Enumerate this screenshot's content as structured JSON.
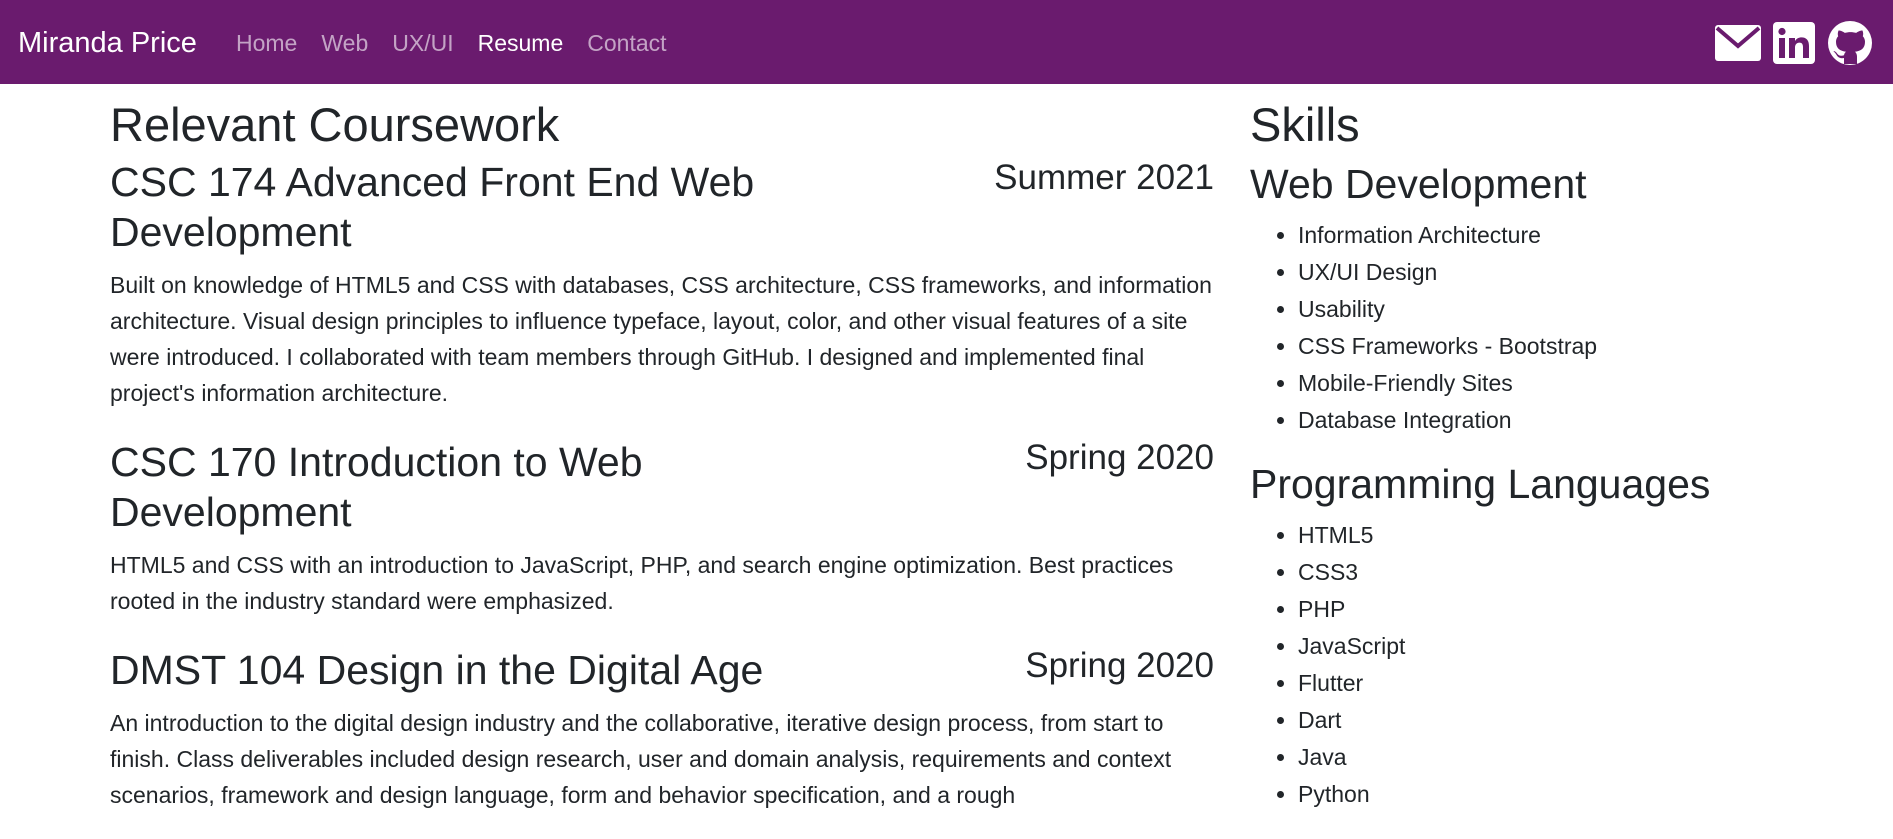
{
  "nav": {
    "brand": "Miranda Price",
    "links": [
      {
        "label": "Home",
        "active": false
      },
      {
        "label": "Web",
        "active": false
      },
      {
        "label": "UX/UI",
        "active": false
      },
      {
        "label": "Resume",
        "active": true
      },
      {
        "label": "Contact",
        "active": false
      }
    ],
    "social_icons": [
      "mail-icon",
      "linkedin-icon",
      "github-icon"
    ],
    "background_color": "#6a1b6e"
  },
  "coursework": {
    "heading": "Relevant Coursework",
    "courses": [
      {
        "title": "CSC 174 Advanced Front End Web Development",
        "term": "Summer 2021",
        "description": "Built on knowledge of HTML5 and CSS with databases, CSS architecture, CSS frameworks, and information architecture. Visual design principles to influence typeface, layout, color, and other visual features of a site were introduced. I collaborated with team members through GitHub. I designed and implemented final project's information architecture."
      },
      {
        "title": "CSC 170 Introduction to Web Development",
        "term": "Spring 2020",
        "description": "HTML5 and CSS with an introduction to JavaScript, PHP, and search engine optimization. Best practices rooted in the industry standard were emphasized."
      },
      {
        "title": "DMST 104 Design in the Digital Age",
        "term": "Spring 2020",
        "description": "An introduction to the digital design industry and the collaborative, iterative design process, from start to finish. Class deliverables included design research, user and domain analysis, requirements and context scenarios, framework and design language, form and behavior specification, and a rough"
      }
    ]
  },
  "skills": {
    "heading": "Skills",
    "groups": [
      {
        "title": "Web Development",
        "items": [
          "Information Architecture",
          "UX/UI Design",
          "Usability",
          "CSS Frameworks - Bootstrap",
          "Mobile-Friendly Sites",
          "Database Integration"
        ]
      },
      {
        "title": "Programming Languages",
        "items": [
          "HTML5",
          "CSS3",
          "PHP",
          "JavaScript",
          "Flutter",
          "Dart",
          "Java",
          "Python"
        ]
      }
    ]
  }
}
